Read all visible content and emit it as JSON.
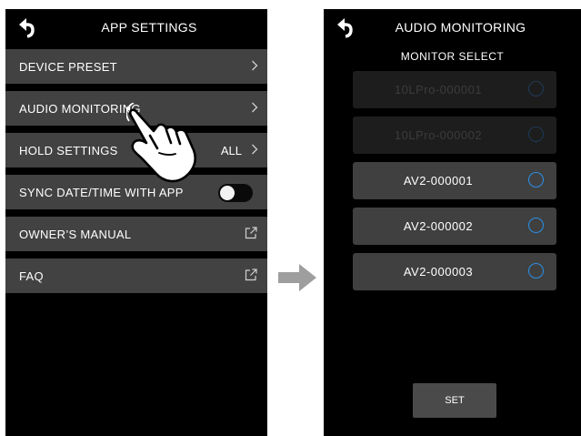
{
  "left_screen": {
    "title": "APP SETTINGS",
    "back_icon": "back-arrow-icon",
    "menu": [
      {
        "label": "DEVICE PRESET",
        "icon": "chevron-right-icon"
      },
      {
        "label": "AUDIO MONITORING",
        "icon": "chevron-right-icon"
      },
      {
        "label": "HOLD SETTINGS",
        "value": "ALL",
        "icon": "chevron-right-icon"
      },
      {
        "label": "SYNC DATE/TIME WITH APP",
        "toggle": "off"
      },
      {
        "label": "OWNER’S MANUAL",
        "icon": "external-link-icon"
      },
      {
        "label": "FAQ",
        "icon": "external-link-icon"
      }
    ],
    "overlay_icon": "pointing-hand-icon"
  },
  "transition_icon": "arrow-right-icon",
  "right_screen": {
    "title": "AUDIO MONITORING",
    "back_icon": "back-arrow-icon",
    "subtitle": "MONITOR SELECT",
    "devices": [
      {
        "name": "10LPro-000001",
        "enabled": false,
        "selected": false
      },
      {
        "name": "10LPro-000002",
        "enabled": false,
        "selected": false
      },
      {
        "name": "AV2-000001",
        "enabled": true,
        "selected": false
      },
      {
        "name": "AV2-000002",
        "enabled": true,
        "selected": false
      },
      {
        "name": "AV2-000003",
        "enabled": true,
        "selected": false
      }
    ],
    "set_label": "SET"
  },
  "colors": {
    "screen_bg": "#000000",
    "menu_bg": "#424242",
    "radio_accent": "#2a8fe6",
    "arrow_gray": "#9e9e9e"
  }
}
